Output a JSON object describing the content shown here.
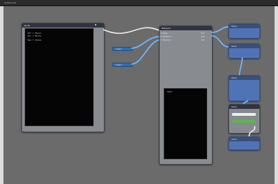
{
  "app": {
    "title": "Untitled.qtz"
  },
  "left_patch": {
    "title": "Sprite",
    "lines": [
      "Str = Hello",
      "Str = Hello",
      "Key = Value"
    ]
  },
  "input_splitters": [
    {
      "label": "Input"
    },
    {
      "label": "Input"
    }
  ],
  "center_patch": {
    "title": "Billboard",
    "inputs": [
      "Image",
      "X Position",
      "Y Position"
    ],
    "outputs": [
      "Out",
      "Out",
      "Out"
    ]
  },
  "center_lower_patch": {
    "title": "Text"
  },
  "right_column": {
    "patches": [
      {
        "title": "Value"
      },
      {
        "title": "Value"
      },
      {
        "title": "Value"
      },
      {
        "title": "Value"
      },
      {
        "title": "Value"
      }
    ]
  }
}
